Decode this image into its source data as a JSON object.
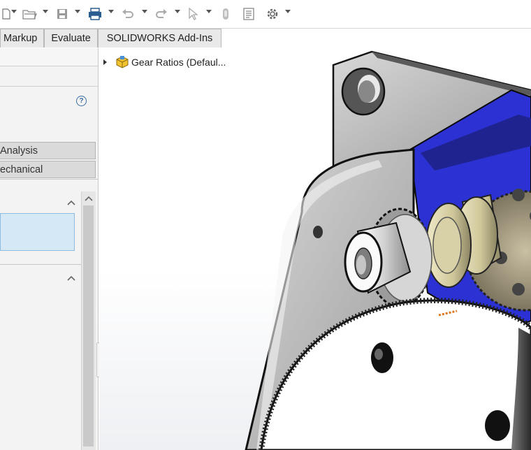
{
  "toolbar": {
    "icons": [
      "new-document-icon",
      "open-folder-icon",
      "save-icon",
      "print-icon",
      "undo-icon",
      "redo-icon",
      "select-arrow-icon",
      "rebuild-icon",
      "file-properties-icon",
      "options-gear-icon"
    ]
  },
  "tabs": [
    {
      "label": "Markup"
    },
    {
      "label": "Evaluate"
    },
    {
      "label": "SOLIDWORKS Add-Ins"
    }
  ],
  "panel": {
    "tab_analysis": "Analysis",
    "tab_mechanical": "echanical",
    "help_symbol": "?"
  },
  "tree": {
    "root_label": "Gear Ratios  (Defaul..."
  },
  "colors": {
    "selection_blue": "#d4e8f6",
    "face_blue": "#2c31d4",
    "gear_tan": "#d9d4bd"
  }
}
